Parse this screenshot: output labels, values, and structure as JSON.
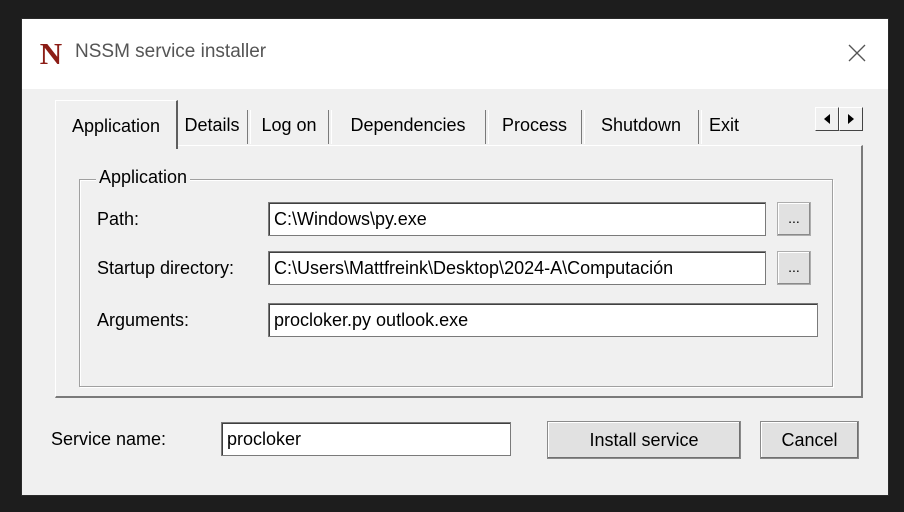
{
  "window": {
    "title": "NSSM service installer",
    "logo_letter": "N",
    "close_icon": "close-icon"
  },
  "tabs": [
    {
      "label": "Application",
      "active": true
    },
    {
      "label": "Details"
    },
    {
      "label": "Log on"
    },
    {
      "label": "Dependencies"
    },
    {
      "label": "Process"
    },
    {
      "label": "Shutdown"
    },
    {
      "label": "Exit"
    }
  ],
  "tab_scroll": {
    "left_icon": "triangle-left-icon",
    "right_icon": "triangle-right-icon"
  },
  "application_group": {
    "title": "Application",
    "path_label": "Path:",
    "path_value": "C:\\Windows\\py.exe",
    "startup_label": "Startup directory:",
    "startup_value": "C:\\Users\\Mattfreink\\Desktop\\2024-A\\Computación",
    "arguments_label": "Arguments:",
    "arguments_value": "procloker.py outlook.exe",
    "browse_label": "..."
  },
  "footer": {
    "service_name_label": "Service name:",
    "service_name_value": "procloker",
    "install_button": "Install service",
    "cancel_button": "Cancel"
  },
  "colors": {
    "logo": "#8c1d16",
    "window_bg": "#f0f0f0",
    "screen_bg": "#1d1d1d"
  }
}
